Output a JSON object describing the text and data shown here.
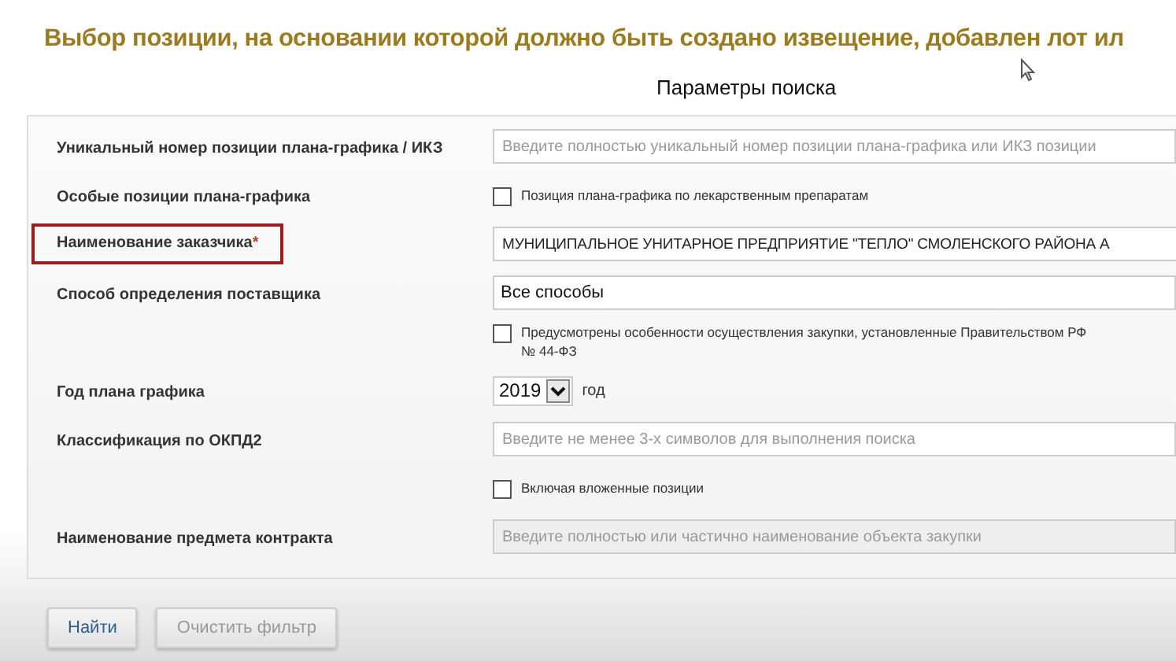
{
  "page_title": "Выбор позиции, на основании которой должно быть создано извещение, добавлен лот ил",
  "section_title": "Параметры поиска",
  "rows": [
    {
      "kind": "input",
      "label": "Уникальный номер позиции плана-графика / ИКЗ",
      "placeholder": "Введите полностью уникальный номер позиции плана-графика или ИКЗ позиции",
      "disabled": false
    },
    {
      "kind": "checkbox",
      "label": "Особые позиции плана-графика",
      "lines": [
        "Позиция плана-графика по лекарственным препаратам"
      ],
      "checked": false
    },
    {
      "kind": "input",
      "label": "Наименование заказчика",
      "value": "МУНИЦИПАЛЬНОЕ УНИТАРНОЕ ПРЕДПРИЯТИЕ \"ТЕПЛО\" СМОЛЕНСКОГО РАЙОНА А",
      "required": true,
      "required_mark": "*",
      "highlighted": true,
      "disabled": false
    },
    {
      "kind": "select",
      "label": "Способ определения поставщика",
      "value": "Все способы"
    },
    {
      "kind": "checkbox",
      "lines": [
        "Предусмотрены особенности осуществления закупки, установленные Правительством РФ",
        "№ 44-ФЗ"
      ],
      "checked": false
    },
    {
      "kind": "year",
      "label": "Год плана графика",
      "value": "2019",
      "suffix": "год"
    },
    {
      "kind": "input",
      "label": "Классификация по ОКПД2",
      "placeholder": "Введите не менее 3-х символов для выполнения поиска",
      "disabled": false
    },
    {
      "kind": "checkbox",
      "lines": [
        "Включая вложенные позиции"
      ],
      "checked": false
    },
    {
      "kind": "input",
      "label": "Наименование предмета контракта",
      "placeholder": "Введите полностью или частично наименование объекта закупки",
      "disabled": true
    }
  ],
  "buttons": [
    {
      "label": "Найти",
      "disabled": false
    },
    {
      "label": "Очистить фильтр",
      "disabled": true
    }
  ]
}
